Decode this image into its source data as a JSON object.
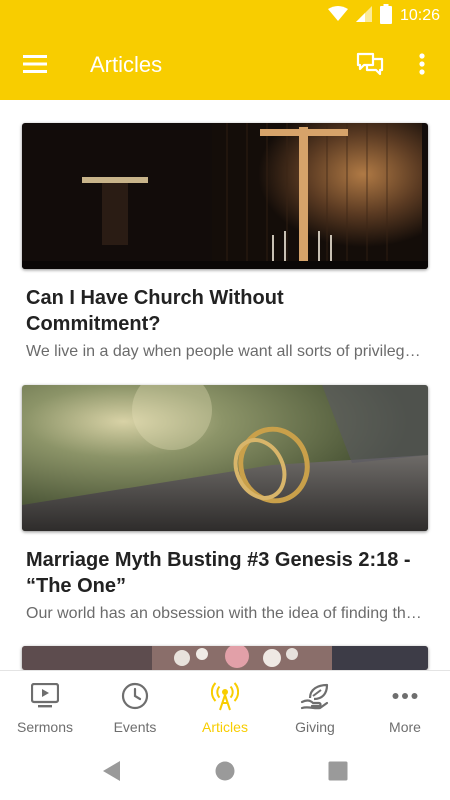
{
  "status_bar": {
    "time": "10:26",
    "icons": [
      "wifi-icon",
      "signal-icon",
      "battery-icon"
    ]
  },
  "app_bar": {
    "title": "Articles",
    "menu_icon": "hamburger-menu-icon",
    "chat_icon": "chat-icon",
    "overflow_icon": "more-vertical-icon"
  },
  "articles": [
    {
      "title": "Can I Have Church Without Commitment?",
      "excerpt": "We live in a day when people want all sorts of privileges without the responsibilities",
      "image": "church-interior-cross"
    },
    {
      "title": "Marriage Myth Busting #3 Genesis 2:18 - “The One”",
      "excerpt": "Our world has an obsession with the idea of finding the one",
      "image": "wedding-rings"
    },
    {
      "title": "",
      "excerpt": "",
      "image": "wedding-bouquet"
    }
  ],
  "bottom_nav": {
    "items": [
      {
        "label": "Sermons",
        "icon": "tv-play-icon"
      },
      {
        "label": "Events",
        "icon": "clock-icon"
      },
      {
        "label": "Articles",
        "icon": "broadcast-icon",
        "active": true
      },
      {
        "label": "Giving",
        "icon": "leaf-hand-icon"
      },
      {
        "label": "More",
        "icon": "more-horizontal-icon"
      }
    ]
  },
  "colors": {
    "accent": "#f8cd00",
    "nav_inactive": "#6e6e6e",
    "title_text": "#222222",
    "excerpt_text": "#6b6b6b"
  }
}
